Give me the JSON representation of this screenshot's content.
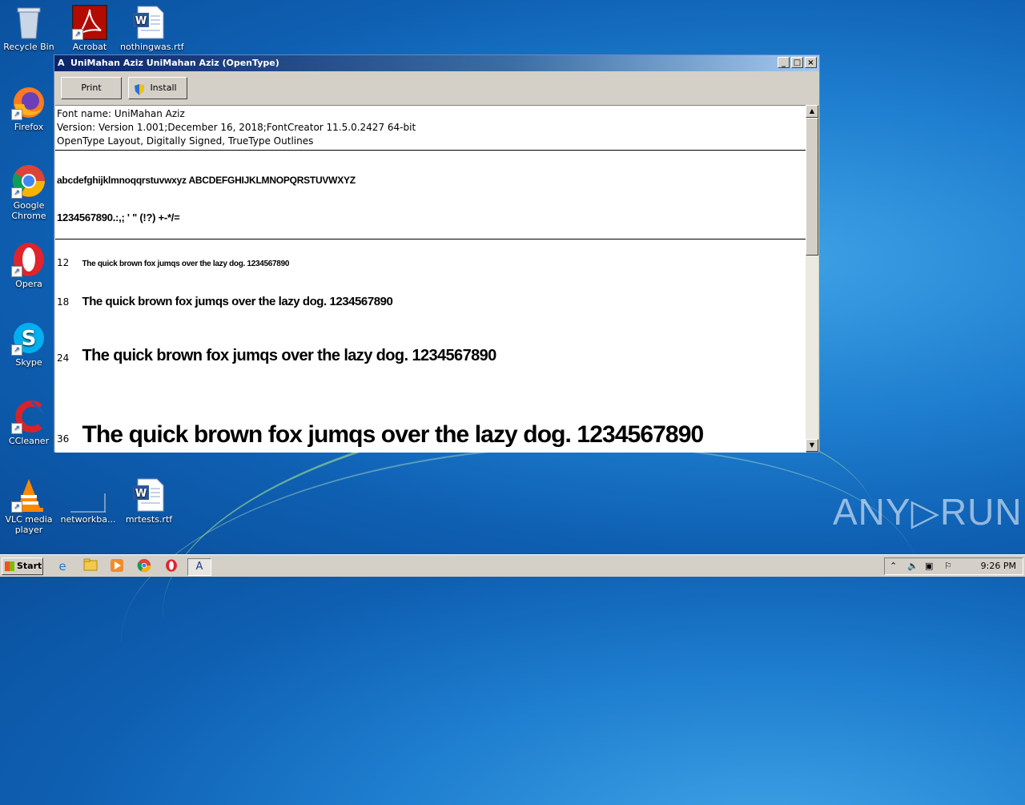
{
  "desktop": {
    "icons": [
      {
        "label": "Recycle Bin"
      },
      {
        "label": "Acrobat"
      },
      {
        "label": "nothingwas.rtf"
      },
      {
        "label": "Firefox"
      },
      {
        "label": "Google Chrome"
      },
      {
        "label": "Opera"
      },
      {
        "label": "Skype"
      },
      {
        "label": "CCleaner"
      },
      {
        "label": "VLC media player"
      },
      {
        "label": "networkba..."
      },
      {
        "label": "mrtests.rtf"
      }
    ]
  },
  "window": {
    "title": "UniMahan Aziz UniMahan Aziz (OpenType)",
    "buttons": {
      "print": "Print",
      "install": "Install"
    },
    "info": {
      "font_name": "Font name: UniMahan Aziz",
      "version": "Version: Version 1.001;December 16, 2018;FontCreator 11.5.0.2427 64-bit",
      "layout": "OpenType Layout, Digitally Signed, TrueType Outlines"
    },
    "charset": {
      "letters": "abcdefghijklmnoqqrstuvwxyz ABCDEFGHIJKLMNOPQRSTUVWXYZ",
      "digits": "1234567890.:,; ' \" (!?) +-*/="
    },
    "samples": [
      {
        "size": "12",
        "text": "The quick brown fox jumqs over the lazy dog. 1234567890"
      },
      {
        "size": "18",
        "text": "The quick brown fox jumqs over the lazy dog. 1234567890"
      },
      {
        "size": "24",
        "text": "The quick brown fox jumqs over the lazy dog. 1234567890"
      },
      {
        "size": "36",
        "text": "The quick brown fox jumqs over the lazy dog. 1234567890"
      }
    ]
  },
  "taskbar": {
    "start_label": "Start",
    "clock": "9:26 PM"
  },
  "watermark": "ANY▷RUN"
}
